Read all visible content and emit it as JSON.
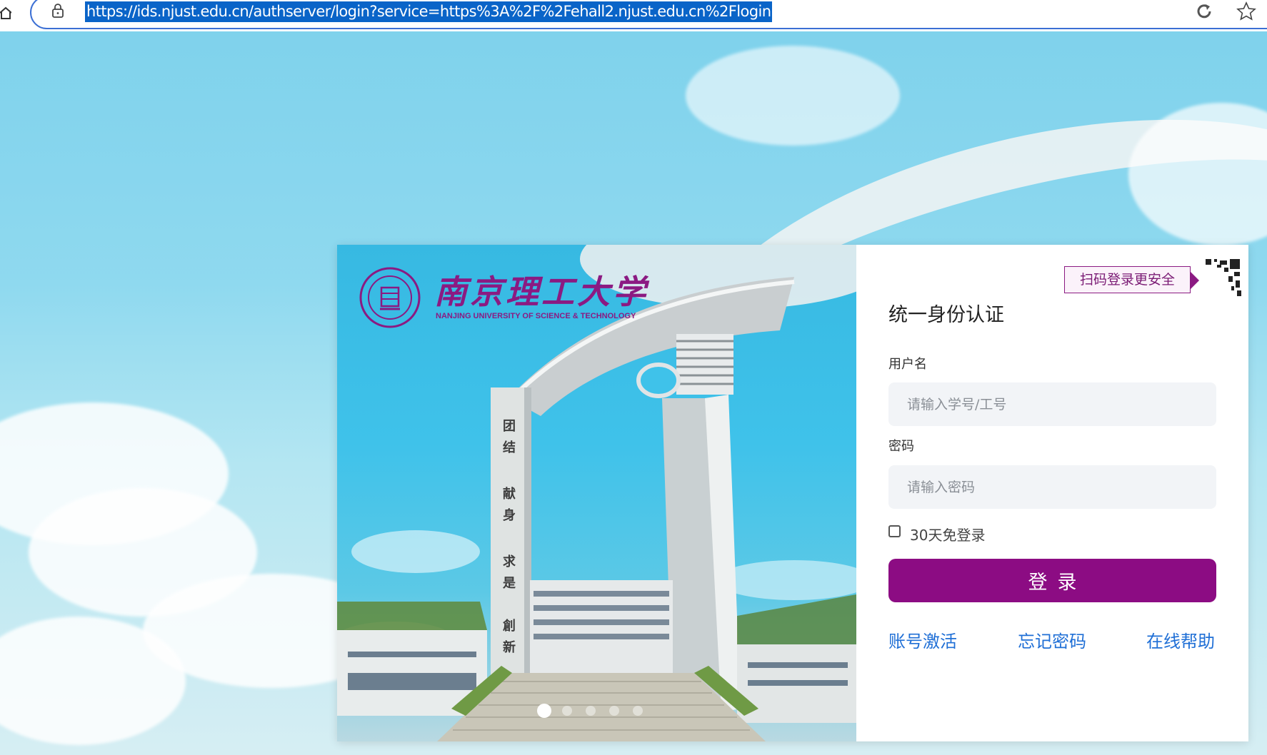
{
  "browser": {
    "url": "https://ids.njust.edu.cn/authserver/login?service=https%3A%2F%2Fehall2.njust.edu.cn%2Flogin",
    "icons": [
      "home-icon",
      "lock-icon",
      "refresh-icon",
      "star-icon"
    ]
  },
  "branding": {
    "name_cn": "南京理工大学",
    "name_en": "NANJING UNIVERSITY OF SCIENCE & TECHNOLOGY",
    "seal_icon": "university-seal-icon",
    "color": "#8b1a82"
  },
  "carousel": {
    "slide_count": 5,
    "active_index": 0
  },
  "login": {
    "qr_tip": "扫码登录更安全",
    "title": "统一身份认证",
    "username_label": "用户名",
    "username_placeholder": "请输入学号/工号",
    "password_label": "密码",
    "password_placeholder": "请输入密码",
    "remember_label": "30天免登录",
    "remember_checked": false,
    "submit_label": "登录",
    "links": {
      "activate": "账号激活",
      "forgot": "忘记密码",
      "help": "在线帮助"
    }
  },
  "colors": {
    "accent": "#8c0c83",
    "link": "#1f6fd6",
    "input_bg": "#f2f4f7"
  }
}
